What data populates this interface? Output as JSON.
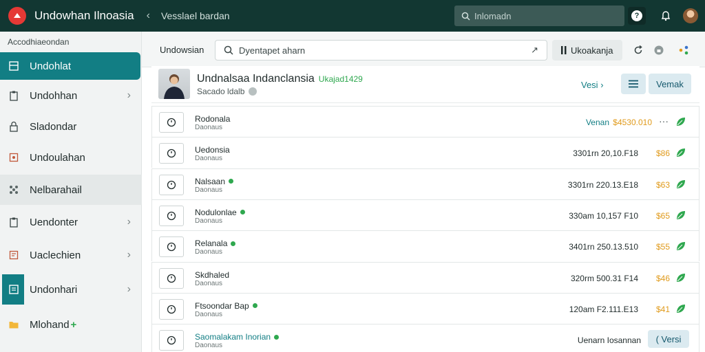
{
  "app": {
    "title": "Undowhan Ilnoasia",
    "subtitle": "Vesslael bardan",
    "search_placeholder": "Inlomadn",
    "help_glyph": "?",
    "accent": "#127e84",
    "topbar_color": "#123732"
  },
  "sidebar": {
    "heading": "Accodhiaeondan",
    "items": [
      {
        "label": "Undohlat",
        "icon": "list-icon",
        "active": true
      },
      {
        "label": "Undohhan",
        "icon": "clipboard-icon",
        "chevron": true
      },
      {
        "label": "Sladondar",
        "icon": "lock-icon"
      },
      {
        "label": "Undoulahan",
        "icon": "document-icon"
      },
      {
        "label": "Nelbarahail",
        "icon": "nodes-icon"
      },
      {
        "label": "Uendonter",
        "icon": "clipboard-icon",
        "chevron": true
      },
      {
        "label": "Uaclechien",
        "icon": "document-icon",
        "chevron": true
      },
      {
        "label": "Undonhari",
        "icon": "list-icon",
        "chevron": true
      },
      {
        "label": "Mlohand",
        "icon": "folder-icon",
        "plus": "+"
      }
    ]
  },
  "toolbar": {
    "label": "Undowsian",
    "search_placeholder": "Dyentapet aharn",
    "arrow": "↗",
    "button_label": "Ukoakanja"
  },
  "profile": {
    "name": "Undnalsaa Indanclansia",
    "tag": "Ukajad1429",
    "sub": "Sacado ldalb",
    "link": "Vesi",
    "button": "Vemak"
  },
  "rows": [
    {
      "title": "Rodonala",
      "sub": "Daonaus",
      "left": "Venan",
      "amount": "$4530.010",
      "dots": true
    },
    {
      "title": "Uedonsia",
      "sub": "Daonaus",
      "left": "3301rn 20,10.F18",
      "amount": "$86"
    },
    {
      "title": "Nalsaan",
      "sub": "Daonaus",
      "dot": true,
      "left": "3301rn 220.13.E18",
      "amount": "$63"
    },
    {
      "title": "Nodulonlae",
      "sub": "Daonaus",
      "dot": true,
      "left": "330am 10,157 F10",
      "amount": "$65"
    },
    {
      "title": "Relanala",
      "sub": "Daonaus",
      "dot": true,
      "left": "3401rn 250.13.510",
      "amount": "$55"
    },
    {
      "title": "Skdhaled",
      "sub": "Daonaus",
      "left": "320rm 500.31 F14",
      "amount": "$46"
    },
    {
      "title": "Ftsoondar Bap",
      "sub": "Daonaus",
      "dot": true,
      "left": "120am F2.111.E13",
      "amount": "$41"
    },
    {
      "title": "Saomalakam Inorian",
      "sub": "Daonaus",
      "dot": true,
      "left": "Uenarn Iosannan",
      "pill": "( Versi"
    }
  ]
}
